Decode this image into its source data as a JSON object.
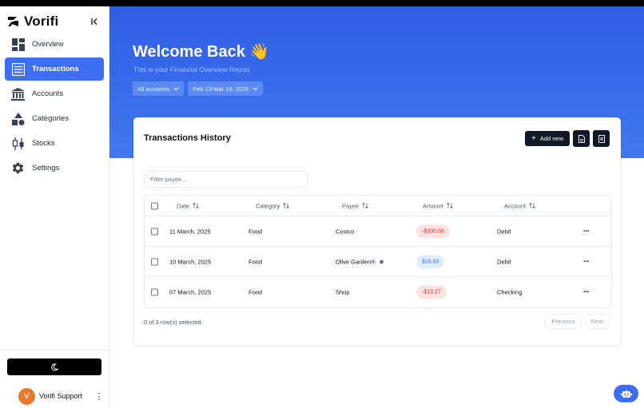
{
  "brand": {
    "name": "Vorifi"
  },
  "sidebar": {
    "items": [
      {
        "label": "Overview",
        "icon": "overview-icon"
      },
      {
        "label": "Transactions",
        "icon": "transactions-icon",
        "active": true
      },
      {
        "label": "Accounts",
        "icon": "bank-icon"
      },
      {
        "label": "Categories",
        "icon": "shapes-icon"
      },
      {
        "label": "Stocks",
        "icon": "candlestick-icon"
      },
      {
        "label": "Settings",
        "icon": "gear-icon"
      }
    ],
    "user": {
      "initial": "V",
      "name": "Vorifi Support"
    }
  },
  "hero": {
    "title": "Welcome Back 👋",
    "subtitle": "This is your Financial Overview Report",
    "account_filter": "All accounts",
    "date_filter": "Feb 13-Mar 16, 2025"
  },
  "card": {
    "title": "Transactions History",
    "add_label": "Add new",
    "filter_placeholder": "Filter payee...",
    "columns": {
      "date": "Date",
      "category": "Category",
      "payee": "Payee",
      "amount": "Amount",
      "account": "Account"
    },
    "rows": [
      {
        "date": "11 March, 2025",
        "category": "Food",
        "payee": "Costco",
        "amount": "-$100.00",
        "amount_type": "neg",
        "account": "Debit"
      },
      {
        "date": "10 March, 2025",
        "category": "Food",
        "payee": "Olive Garden®",
        "amount": "$18.93",
        "amount_type": "pos",
        "account": "Debit"
      },
      {
        "date": "07 March, 2025",
        "category": "Food",
        "payee": "Shop",
        "amount": "-$13.27",
        "amount_type": "neg",
        "account": "Checking"
      }
    ],
    "selected_info": "0 of 3 row(s) selected.",
    "previous": "Previous",
    "next": "Next"
  },
  "colors": {
    "accent": "#3b6ef5",
    "hero_top": "#2f5de6",
    "negative": "#dc2626",
    "avatar": "#e57a2f"
  }
}
